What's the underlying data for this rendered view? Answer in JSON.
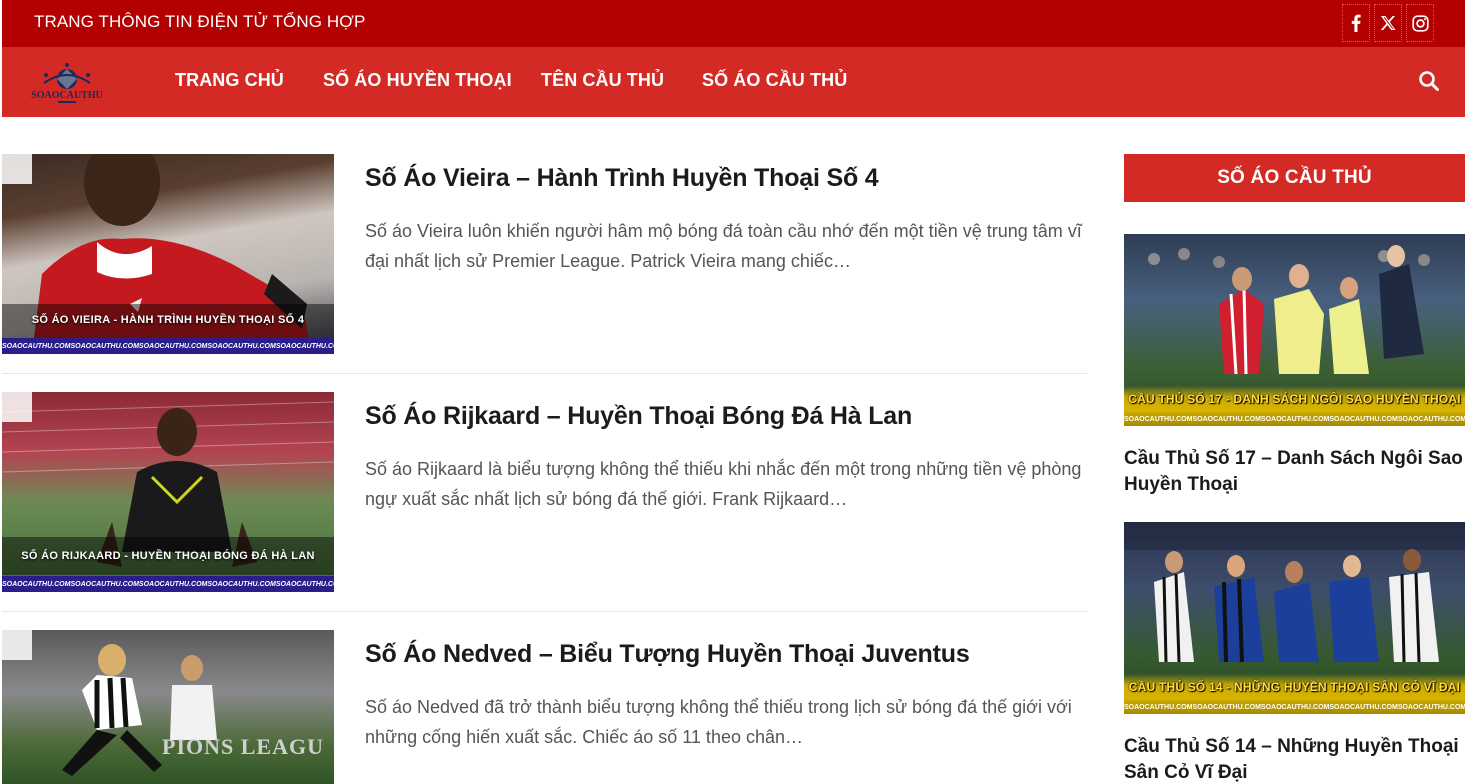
{
  "topbar": {
    "text": "TRANG THÔNG TIN ĐIỆN TỬ TỔNG HỢP",
    "social_icons": [
      "facebook-icon",
      "x-twitter-icon",
      "instagram-icon"
    ]
  },
  "brand": {
    "logo_text": "SOAOCAUTHU",
    "primary_color": "#d42a26",
    "topbar_color": "#b30000"
  },
  "nav": {
    "items": [
      "TRANG CHỦ",
      "SỐ ÁO HUYỀN THOẠI",
      "TÊN CẦU THỦ",
      "SỐ ÁO CẦU THỦ"
    ],
    "search_icon": "search-icon"
  },
  "articles": [
    {
      "title": "Số Áo Vieira – Hành Trình Huyền Thoại Số 4",
      "excerpt": "Số áo Vieira luôn khiến người hâm mộ bóng đá toàn cầu nhớ đến một tiền vệ trung tâm vĩ đại nhất lịch sử Premier League. Patrick Vieira mang chiếc…",
      "thumb_caption": "SỐ ÁO VIEIRA - HÀNH TRÌNH HUYỀN THOẠI SỐ 4",
      "thumb_strip": "SOAOCAUTHU.COM"
    },
    {
      "title": "Số Áo Rijkaard – Huyền Thoại Bóng Đá Hà Lan",
      "excerpt": "Số áo Rijkaard là biểu tượng không thể thiếu khi nhắc đến một trong những tiền vệ phòng ngự xuất sắc nhất lịch sử bóng đá thế giới. Frank Rijkaard…",
      "thumb_caption": "SỐ ÁO RIJKAARD - HUYỀN THOẠI BÓNG ĐÁ HÀ LAN",
      "thumb_strip": "SOAOCAUTHU.COM"
    },
    {
      "title": "Số Áo Nedved – Biểu Tượng Huyền Thoại Juventus",
      "excerpt": "Số áo Nedved đã trở thành biểu tượng không thể thiếu trong lịch sử bóng đá thế giới với những cống hiến xuất sắc. Chiếc áo số 11 theo chân…",
      "thumb_caption": "PIONS LEAGU",
      "thumb_strip": ""
    }
  ],
  "sidebar": {
    "heading": "SỐ ÁO CẦU THỦ",
    "cards": [
      {
        "title": "Cầu Thủ Số 17 – Danh Sách Ngôi Sao Huyền Thoại",
        "thumb_caption": "CẦU THỦ SỐ 17 - DANH SÁCH NGÔI SAO HUYỀN THOẠI",
        "thumb_strip": "SOAOCAUTHU.COM"
      },
      {
        "title": "Cầu Thủ Số 14 – Những Huyền Thoại Sân Cỏ Vĩ Đại",
        "thumb_caption": "CẦU THỦ SỐ 14 - NHỮNG HUYỀN THOẠI SÂN CỎ VĨ ĐẠI",
        "thumb_strip": "SOAOCAUTHU.COM"
      }
    ]
  }
}
